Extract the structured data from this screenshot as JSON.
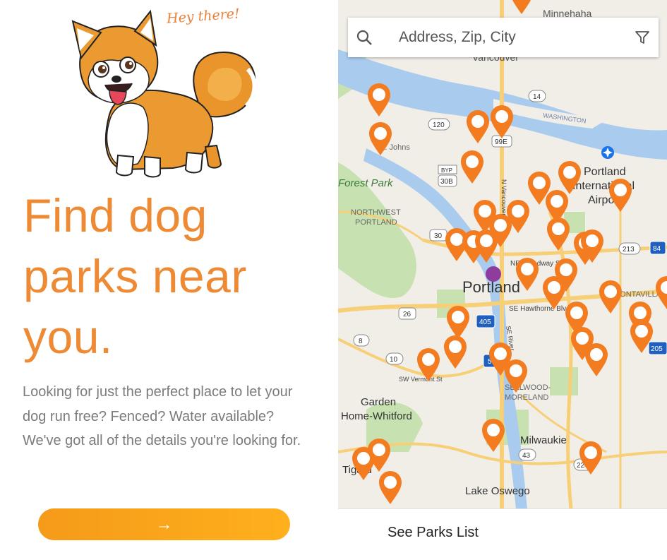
{
  "intro": {
    "greeting": "Hey there!",
    "headline_lines": [
      "Find dog",
      "parks near",
      "you."
    ],
    "description": "Looking for just the perfect place to let your dog run free? Fenced? Water available? We've got all of the details you're looking for.",
    "cta_icon": "arrow-right-icon",
    "cta_symbol": "→",
    "mascot": "shiba-dog-illustration"
  },
  "search": {
    "placeholder": "Address, Zip, City",
    "search_icon": "search-icon",
    "filter_icon": "filter-icon"
  },
  "map": {
    "labels": {
      "minnehaha": "Minnehaha",
      "vancouver": "Vancouver",
      "washington": "WASHINGTON",
      "portland_intl_1": "Portland",
      "portland_intl_2": "International",
      "portland_intl_3": "Airport",
      "forest_park": "Forest Park",
      "northwest_portland_1": "NORTHWEST",
      "northwest_portland_2": "PORTLAND",
      "st_johns": "St. Johns",
      "portland": "Portland",
      "ne_broadway": "NE Broadway St",
      "se_hawthorne": "SE Hawthorne Blvd",
      "montavilla": "MONTAVILLA",
      "n_vancouver_ave": "N Vancouver Ave",
      "sw_vermont": "SW Vermont St",
      "garden_home_1": "Garden",
      "garden_home_2": "Home-Whitford",
      "sellwood_1": "SELLWOOD-",
      "sellwood_2": "MORELAND",
      "milwaukie": "Milwaukie",
      "lake_oswego": "Lake Oswego",
      "tigard": "Tigard",
      "se_river": "SE River"
    },
    "shields": {
      "r14": "14",
      "r120": "120",
      "r99e": "99E",
      "byp": "BYP",
      "r30b": "30B",
      "r30": "30",
      "r213": "213",
      "r84": "84",
      "r26": "26",
      "r405": "405",
      "r8": "8",
      "r10": "10",
      "r5": "5",
      "r43": "43",
      "r224": "224",
      "r205": "205",
      "r5n": "5"
    },
    "marker_icon": "map-pin-icon",
    "location_icon": "current-location-icon",
    "airport_icon": "airport-icon",
    "colors": {
      "marker": "#f47c20",
      "current_location": "#8e3d9e",
      "water": "#a9cbee",
      "park": "#c7e2b0",
      "highway": "#f7cf76",
      "land": "#f1eee8"
    }
  },
  "footer": {
    "see_parks_list": "See Parks List"
  }
}
